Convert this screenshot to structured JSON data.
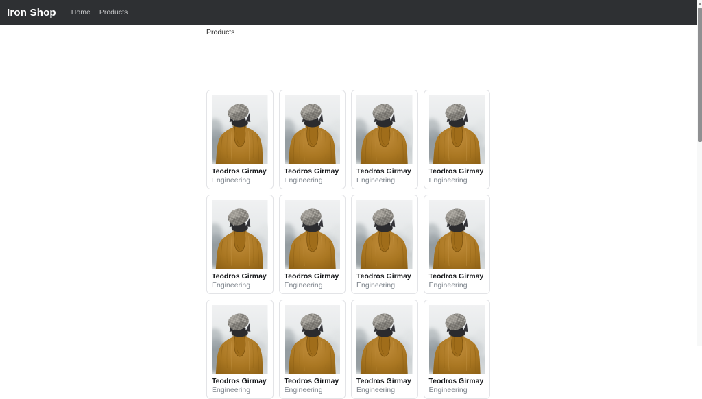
{
  "navbar": {
    "brand": "Iron Shop",
    "links": [
      {
        "label": "Home"
      },
      {
        "label": "Products"
      }
    ]
  },
  "page": {
    "heading": "Products"
  },
  "products": {
    "photo": "person-back-mustard-jacket-knit-beanie",
    "items": [
      {
        "name": "Teodros Girmay",
        "role": "Engineering"
      },
      {
        "name": "Teodros Girmay",
        "role": "Engineering"
      },
      {
        "name": "Teodros Girmay",
        "role": "Engineering"
      },
      {
        "name": "Teodros Girmay",
        "role": "Engineering"
      },
      {
        "name": "Teodros Girmay",
        "role": "Engineering"
      },
      {
        "name": "Teodros Girmay",
        "role": "Engineering"
      },
      {
        "name": "Teodros Girmay",
        "role": "Engineering"
      },
      {
        "name": "Teodros Girmay",
        "role": "Engineering"
      },
      {
        "name": "Teodros Girmay",
        "role": "Engineering"
      },
      {
        "name": "Teodros Girmay",
        "role": "Engineering"
      },
      {
        "name": "Teodros Girmay",
        "role": "Engineering"
      },
      {
        "name": "Teodros Girmay",
        "role": "Engineering"
      }
    ]
  },
  "colors": {
    "navbar_bg": "#2e3033",
    "brand_text": "#ffffff",
    "nav_link": "#c8c9cb",
    "card_border": "#e3e4e7",
    "name_text": "#17191c",
    "role_text": "#7d848c",
    "jacket": "#aa7722",
    "beanie": "#8f8c86",
    "photo_bg_top": "#f0f1f2",
    "photo_bg_bottom": "#c6cbce",
    "scrollbar_thumb": "#8f9092"
  }
}
